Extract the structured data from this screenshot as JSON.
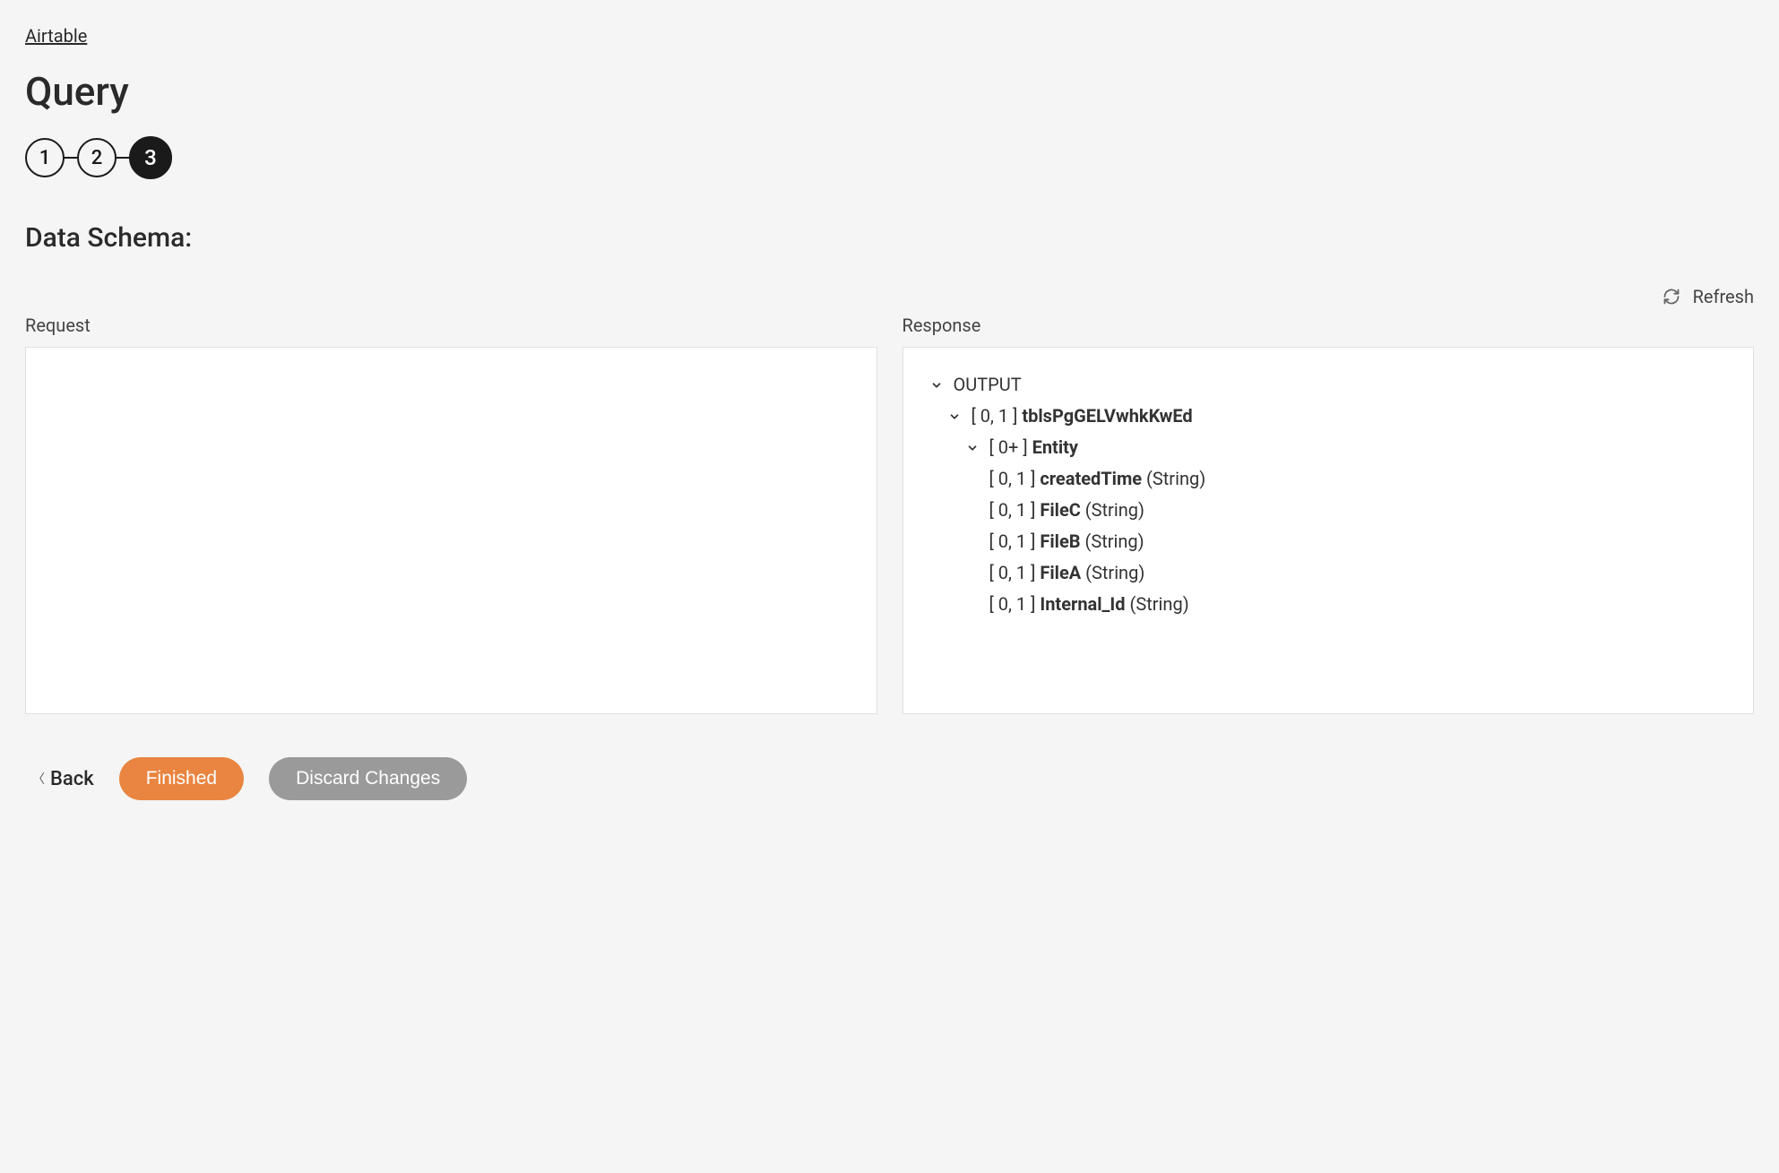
{
  "breadcrumb": "Airtable",
  "pageTitle": "Query",
  "stepper": {
    "steps": [
      "1",
      "2",
      "3"
    ],
    "activeIndex": 2
  },
  "sectionTitle": "Data Schema:",
  "refreshLabel": "Refresh",
  "panels": {
    "request": {
      "label": "Request"
    },
    "response": {
      "label": "Response",
      "tree": {
        "root": {
          "label": "OUTPUT",
          "children": [
            {
              "cardinality": "[ 0, 1 ]",
              "name": "tblsPgGELVwhkKwEd",
              "children": [
                {
                  "cardinality": "[ 0+ ]",
                  "name": "Entity",
                  "children": [
                    {
                      "cardinality": "[ 0, 1 ]",
                      "name": "createdTime",
                      "type": "(String)"
                    },
                    {
                      "cardinality": "[ 0, 1 ]",
                      "name": "FileC",
                      "type": "(String)"
                    },
                    {
                      "cardinality": "[ 0, 1 ]",
                      "name": "FileB",
                      "type": "(String)"
                    },
                    {
                      "cardinality": "[ 0, 1 ]",
                      "name": "FileA",
                      "type": "(String)"
                    },
                    {
                      "cardinality": "[ 0, 1 ]",
                      "name": "Internal_Id",
                      "type": "(String)"
                    }
                  ]
                }
              ]
            }
          ]
        }
      }
    }
  },
  "footer": {
    "back": "Back",
    "finished": "Finished",
    "discard": "Discard Changes"
  }
}
